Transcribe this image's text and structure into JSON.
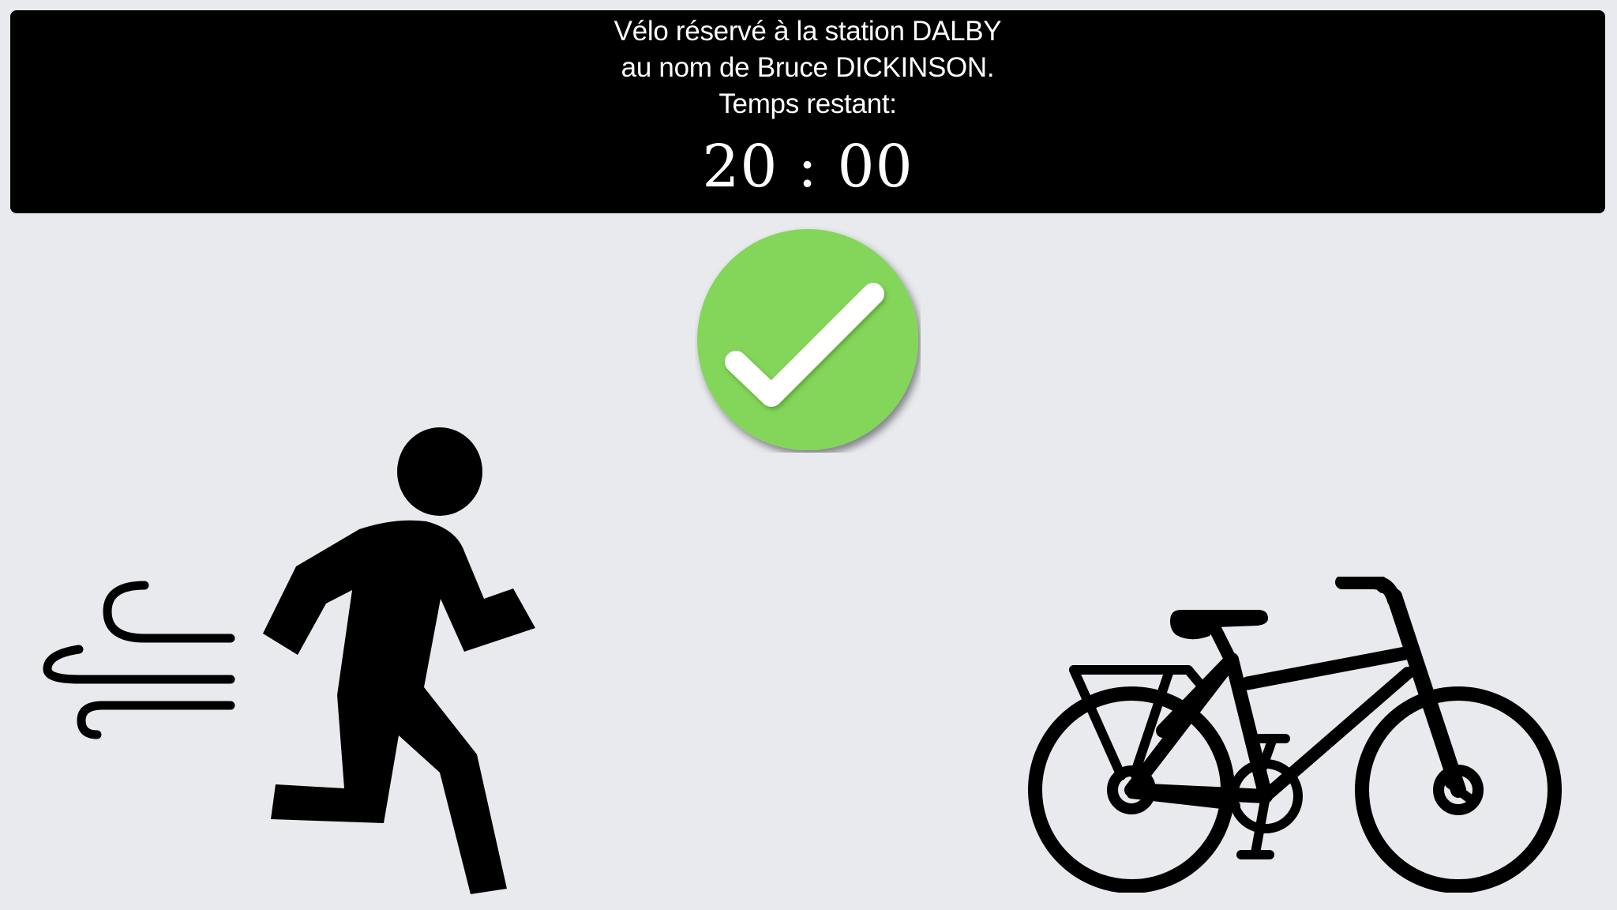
{
  "reservation": {
    "line1": "Vélo réservé à la station DALBY",
    "line2": "au nom de Bruce DICKINSON.",
    "line3": "Temps restant:",
    "timer": "20 : 00"
  },
  "icons": {
    "status": "check-icon",
    "runner": "running-person-icon",
    "bicycle": "bicycle-icon"
  },
  "colors": {
    "background": "#e8eaee",
    "banner": "#000000",
    "banner_text": "#ffffff",
    "check_green": "#84d65a",
    "icon_black": "#000000"
  }
}
